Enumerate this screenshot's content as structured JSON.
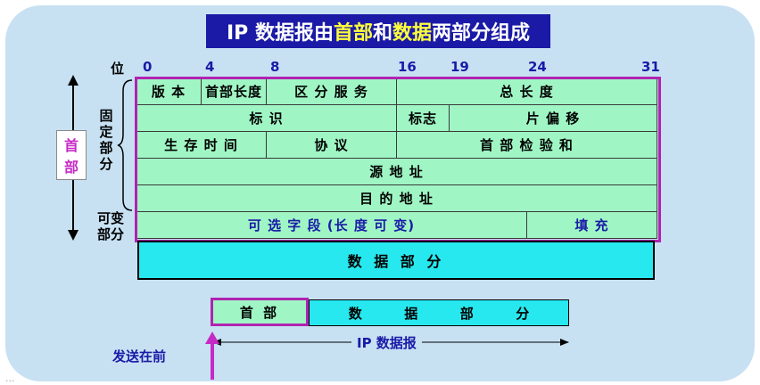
{
  "title": {
    "pre": "IP 数据报由",
    "hl1": "首部",
    "mid": "和",
    "hl2": "数据",
    "post": "两部分组成"
  },
  "bit_label": "位",
  "bit_ticks": [
    "0",
    "4",
    "8",
    "16",
    "19",
    "24",
    "31"
  ],
  "header_rows": [
    [
      "版 本",
      "首部长度",
      "区 分 服 务",
      "总 长 度"
    ],
    [
      "标 识",
      "标志",
      "片 偏 移"
    ],
    [
      "生 存 时 间",
      "协 议",
      "首 部 检 验 和"
    ],
    [
      "源 地 址"
    ],
    [
      "目 的 地 址"
    ],
    [
      "可 选 字 段 (长 度 可 变)",
      "填 充"
    ]
  ],
  "data_part": "数 据 部 分",
  "side": {
    "header_chars": [
      "首",
      "部"
    ],
    "fixed_chars": [
      "固",
      "定",
      "部",
      "分"
    ],
    "variable": [
      "可变",
      "部分"
    ]
  },
  "datagram": {
    "header": "首 部",
    "data_chars": [
      "数",
      "据",
      "部",
      "分"
    ],
    "label": "IP 数据报"
  },
  "send_first": "发送在前",
  "watermark": "...",
  "colors": {
    "title_bg": "#1a1aa6",
    "highlight": "#ffff3c",
    "header_cell": "#9ff6c4",
    "data": "#26e8ee",
    "frame": "#b123b1",
    "text_blue": "#1a1aa6"
  }
}
